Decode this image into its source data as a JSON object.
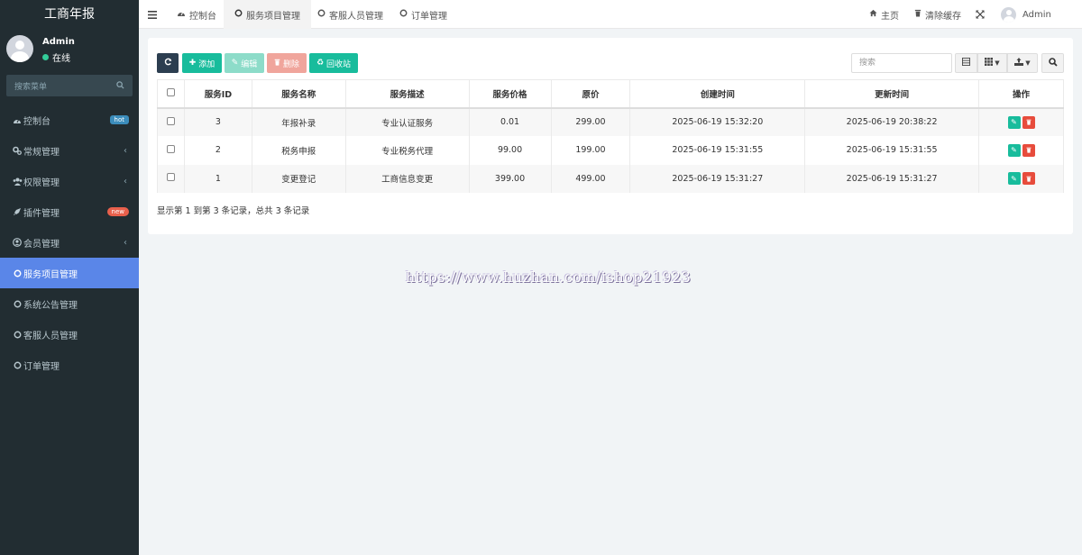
{
  "app": {
    "title": "工商年报"
  },
  "user": {
    "name": "Admin",
    "status": "在线"
  },
  "sidebar": {
    "search_placeholder": "搜索菜单",
    "items": [
      {
        "label": "控制台",
        "icon": "dashboard-icon",
        "badge": "hot"
      },
      {
        "label": "常规管理",
        "icon": "cogs-icon"
      },
      {
        "label": "权限管理",
        "icon": "users-icon"
      },
      {
        "label": "插件管理",
        "icon": "rocket-icon",
        "badge": "new"
      },
      {
        "label": "会员管理",
        "icon": "user-circle-icon"
      },
      {
        "label": "服务项目管理",
        "icon": "circle-o-icon",
        "active": true
      },
      {
        "label": "系统公告管理",
        "icon": "circle-o-icon"
      },
      {
        "label": "客服人员管理",
        "icon": "circle-o-icon"
      },
      {
        "label": "订单管理",
        "icon": "circle-o-icon"
      }
    ]
  },
  "topbar": {
    "tabs": [
      {
        "label": "控制台",
        "icon": "dashboard-icon"
      },
      {
        "label": "服务项目管理",
        "icon": "circle-o-icon",
        "active": true
      },
      {
        "label": "客服人员管理",
        "icon": "circle-o-icon"
      },
      {
        "label": "订单管理",
        "icon": "circle-o-icon"
      }
    ],
    "home": "主页",
    "clear_cache": "清除缓存",
    "user": "Admin"
  },
  "toolbar": {
    "add": "添加",
    "edit": "编辑",
    "delete": "删除",
    "recycle": "回收站",
    "search_placeholder": "搜索"
  },
  "table": {
    "headers": [
      "服务ID",
      "服务名称",
      "服务描述",
      "服务价格",
      "原价",
      "创建时间",
      "更新时间",
      "操作"
    ],
    "rows": [
      [
        "3",
        "年报补录",
        "专业认证服务",
        "0.01",
        "299.00",
        "2025-06-19 15:32:20",
        "2025-06-19 20:38:22"
      ],
      [
        "2",
        "税务申报",
        "专业税务代理",
        "99.00",
        "199.00",
        "2025-06-19 15:31:55",
        "2025-06-19 15:31:55"
      ],
      [
        "1",
        "变更登记",
        "工商信息变更",
        "399.00",
        "499.00",
        "2025-06-19 15:31:27",
        "2025-06-19 15:31:27"
      ]
    ],
    "footer": "显示第 1 到第 3 条记录，总共 3 条记录"
  },
  "watermark": "https://www.huzhan.com/ishop21923",
  "colors": {
    "sidebar": "#222d32",
    "active": "#5a86e8",
    "success": "#18bc9c",
    "danger": "#e74c3c",
    "dark_btn": "#2c3e50"
  }
}
